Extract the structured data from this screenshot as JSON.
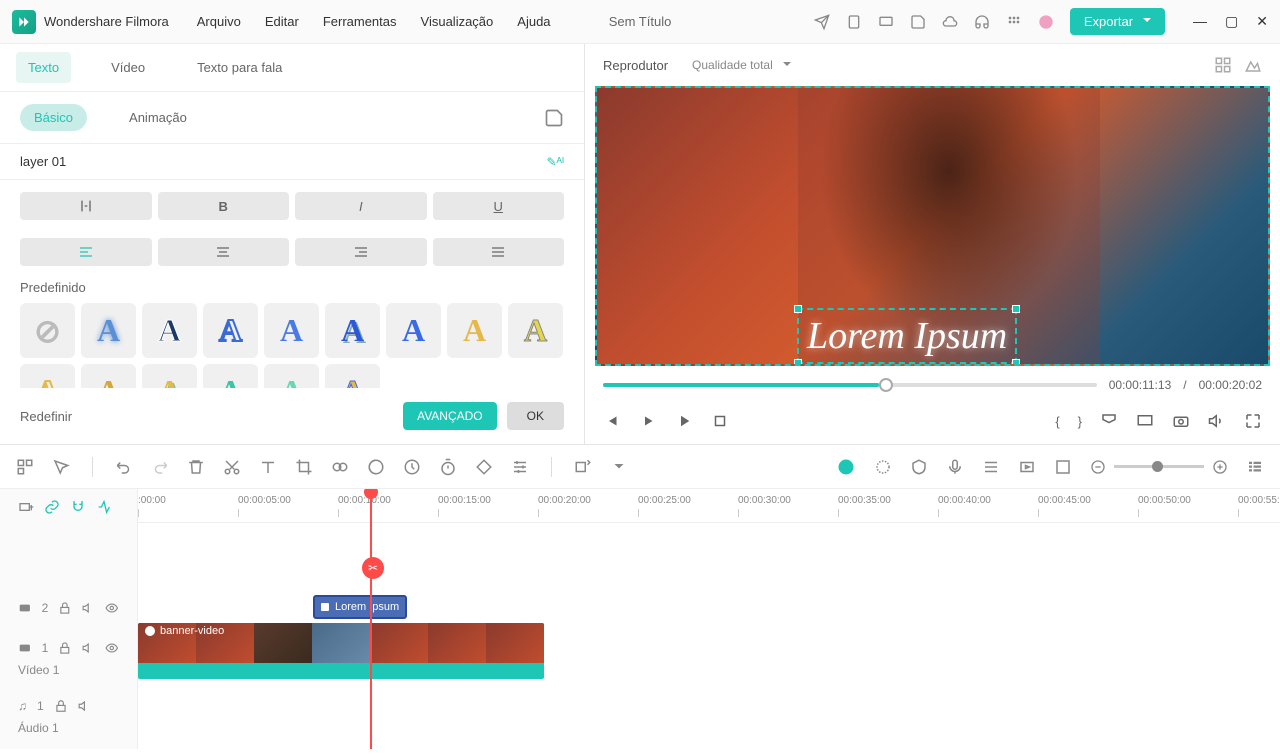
{
  "app": {
    "name": "Wondershare Filmora",
    "docTitle": "Sem Título"
  },
  "menu": [
    "Arquivo",
    "Editar",
    "Ferramentas",
    "Visualização",
    "Ajuda"
  ],
  "exportLabel": "Exportar",
  "leftTabs": {
    "text": "Texto",
    "video": "Vídeo",
    "tts": "Texto para fala"
  },
  "subTabs": {
    "basic": "Básico",
    "anim": "Animação"
  },
  "layerLabel": "layer 01",
  "presetLabel": "Predefinido",
  "footer": {
    "reset": "Redefinir",
    "advanced": "AVANÇADO",
    "ok": "OK"
  },
  "player": {
    "label": "Reprodutor",
    "quality": "Qualidade total",
    "overlayText": "Lorem Ipsum",
    "currentTime": "00:00:11:13",
    "totalTime": "00:00:20:02"
  },
  "timeline": {
    "ruler": [
      ":00:00",
      "00:00:05:00",
      "00:00:10:00",
      "00:00:15:00",
      "00:00:20:00",
      "00:00:25:00",
      "00:00:30:00",
      "00:00:35:00",
      "00:00:40:00",
      "00:00:45:00",
      "00:00:50:00",
      "00:00:55:"
    ],
    "textClip": "Lorem Ipsum",
    "videoClip": "banner-video",
    "trackVideo": "Vídeo 1",
    "trackAudio": "Áudio 1",
    "trackNum2": "2",
    "trackNum1": "1"
  }
}
